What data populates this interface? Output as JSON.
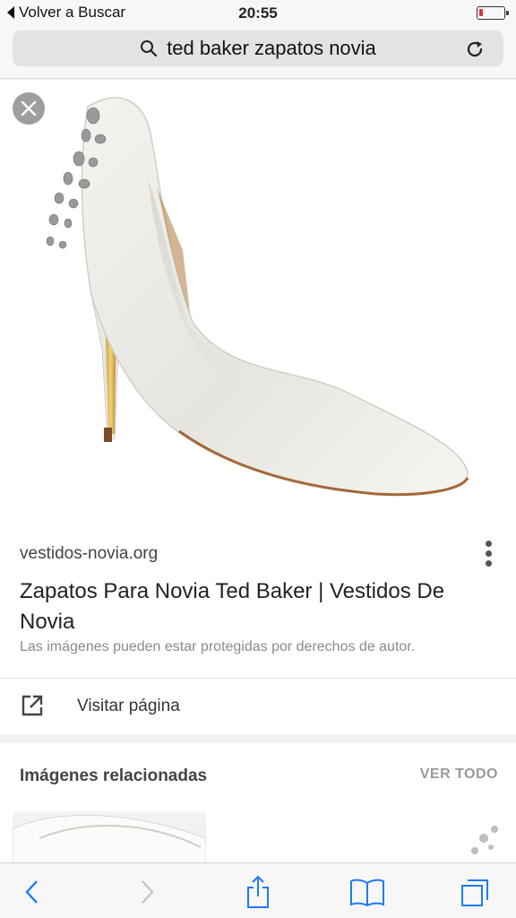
{
  "status_bar": {
    "back_label": "Volver a Buscar",
    "time": "20:55",
    "battery_color": "#e0312f"
  },
  "url_bar": {
    "query": "ted baker zapatos novia",
    "left_icon": "search-icon",
    "right_icon": "reload-icon"
  },
  "image_viewer": {
    "close_icon": "close-icon",
    "image_subject": "white satin pointed-toe pump with jeweled heel"
  },
  "result": {
    "source": "vestidos-novia.org",
    "title": "Zapatos Para Novia Ted Baker | Vestidos De Novia",
    "copyright_note": "Las imágenes pueden estar protegidas por derechos de autor.",
    "visit_label": "Visitar página",
    "visit_icon": "open-external-icon",
    "more_icon": "more-vertical-icon"
  },
  "related": {
    "header": "Imágenes relacionadas",
    "view_all": "VER TODO"
  },
  "toolbar": {
    "items": [
      "back-icon",
      "forward-icon",
      "share-icon",
      "bookmarks-icon",
      "tabs-icon"
    ],
    "accent": "#1e7bf6"
  }
}
